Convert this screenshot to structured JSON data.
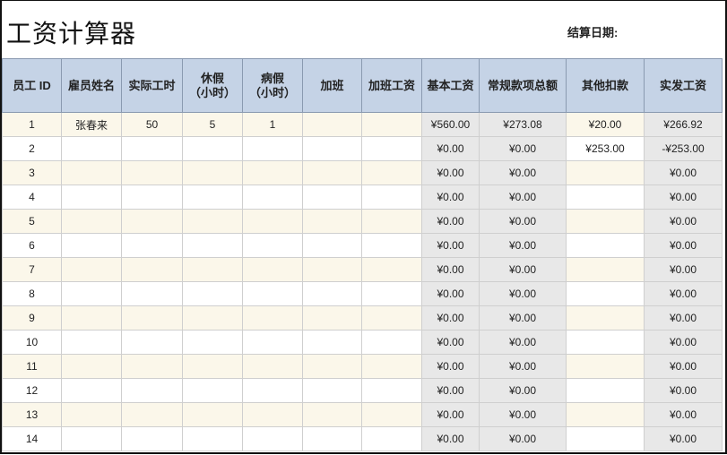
{
  "title": "工资计算器",
  "date_label": "结算日期:",
  "headers": [
    "员工 ID",
    "雇员姓名",
    "实际工时",
    "休假\n（小时）",
    "病假\n（小时）",
    "加班",
    "加班工资",
    "基本工资",
    "常规款项总额",
    "其他扣款",
    "实发工资"
  ],
  "rows": [
    [
      "1",
      "张春来",
      "50",
      "5",
      "1",
      "",
      "",
      "¥560.00",
      "¥273.08",
      "¥20.00",
      "¥266.92"
    ],
    [
      "2",
      "",
      "",
      "",
      "",
      "",
      "",
      "¥0.00",
      "¥0.00",
      "¥253.00",
      "-¥253.00"
    ],
    [
      "3",
      "",
      "",
      "",
      "",
      "",
      "",
      "¥0.00",
      "¥0.00",
      "",
      "¥0.00"
    ],
    [
      "4",
      "",
      "",
      "",
      "",
      "",
      "",
      "¥0.00",
      "¥0.00",
      "",
      "¥0.00"
    ],
    [
      "5",
      "",
      "",
      "",
      "",
      "",
      "",
      "¥0.00",
      "¥0.00",
      "",
      "¥0.00"
    ],
    [
      "6",
      "",
      "",
      "",
      "",
      "",
      "",
      "¥0.00",
      "¥0.00",
      "",
      "¥0.00"
    ],
    [
      "7",
      "",
      "",
      "",
      "",
      "",
      "",
      "¥0.00",
      "¥0.00",
      "",
      "¥0.00"
    ],
    [
      "8",
      "",
      "",
      "",
      "",
      "",
      "",
      "¥0.00",
      "¥0.00",
      "",
      "¥0.00"
    ],
    [
      "9",
      "",
      "",
      "",
      "",
      "",
      "",
      "¥0.00",
      "¥0.00",
      "",
      "¥0.00"
    ],
    [
      "10",
      "",
      "",
      "",
      "",
      "",
      "",
      "¥0.00",
      "¥0.00",
      "",
      "¥0.00"
    ],
    [
      "11",
      "",
      "",
      "",
      "",
      "",
      "",
      "¥0.00",
      "¥0.00",
      "",
      "¥0.00"
    ],
    [
      "12",
      "",
      "",
      "",
      "",
      "",
      "",
      "¥0.00",
      "¥0.00",
      "",
      "¥0.00"
    ],
    [
      "13",
      "",
      "",
      "",
      "",
      "",
      "",
      "¥0.00",
      "¥0.00",
      "",
      "¥0.00"
    ],
    [
      "14",
      "",
      "",
      "",
      "",
      "",
      "",
      "¥0.00",
      "¥0.00",
      "",
      "¥0.00"
    ]
  ]
}
